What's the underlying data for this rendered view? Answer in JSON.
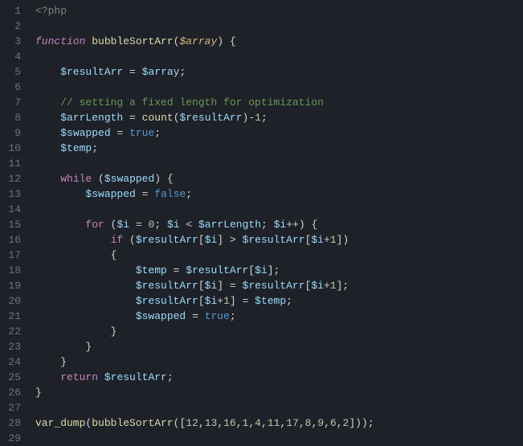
{
  "lineCount": 29,
  "tokens": {
    "php_open": "<?php",
    "kw_function": "function",
    "fn_bubbleSortArr": "bubbleSortArr",
    "param_array": "$array",
    "var_resultArr": "$resultArr",
    "var_array": "$array",
    "comment_opt": "// setting a fixed length for optimization",
    "var_arrLength": "$arrLength",
    "fn_count": "count",
    "var_swapped": "$swapped",
    "bool_true": "true",
    "bool_false": "false",
    "var_temp": "$temp",
    "kw_while": "while",
    "kw_for": "for",
    "var_i": "$i",
    "kw_if": "if",
    "kw_return": "return",
    "fn_var_dump": "var_dump",
    "num_0": "0",
    "num_1": "1",
    "num_minus1": "1",
    "arr_nums": "12,13,16,1,4,11,17,8,9,6,2",
    "op_eq": "=",
    "op_lt": "<",
    "op_gt": ">",
    "op_minus": "-",
    "op_plus": "+",
    "op_pp": "++",
    "brace_open": "{",
    "brace_close": "}",
    "paren_open": "(",
    "paren_close": ")",
    "bracket_open": "[",
    "bracket_close": "]",
    "semi": ";"
  },
  "chart_data": null
}
